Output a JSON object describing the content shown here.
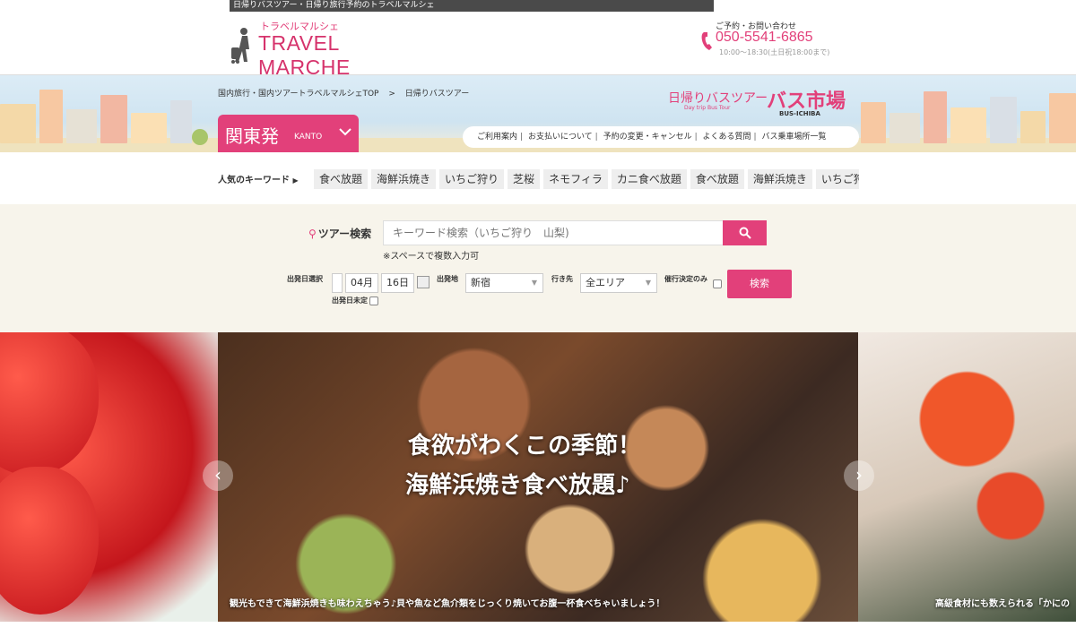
{
  "top_strip": {
    "text": "日帰りバスツアー・日帰り旅行予約のトラベルマルシェ"
  },
  "header": {
    "logo_ruby": "トラベルマルシェ",
    "logo_brand": "TRAVEL MARCHE",
    "contact_label": "ご予約・お問い合わせ",
    "contact_tel": "050-5541-6865",
    "contact_hours": "10:00〜18:30(土日祝18:00まで)"
  },
  "breadcrumb": [
    "国内旅行・国内ツアートラベルマルシェTOP",
    ">",
    "日帰りバスツアー"
  ],
  "region": {
    "label_jp": "関東発",
    "label_en": "KANTO"
  },
  "bus_market": {
    "daytrip_label": "日帰りバスツアー",
    "daytrip_sub": "Day trip Bus Tour",
    "busichiba_label": "バス市場",
    "busichiba_sub": "BUS-ICHIBA"
  },
  "subnav": [
    "ご利用案内",
    "お支払いについて",
    "予約の変更・キャンセル",
    "よくある質問",
    "バス乗車場所一覧"
  ],
  "keywords": {
    "label": "人気のキーワード",
    "tags": [
      "食べ放題",
      "海鮮浜焼き",
      "いちご狩り",
      "芝桜",
      "ネモフィラ",
      "カニ食べ放題",
      "食べ放題",
      "海鮮浜焼き",
      "いちご狩り"
    ]
  },
  "search": {
    "title": "ツアー検索",
    "placeholder": "キーワード検索（いちご狩り　山梨)",
    "note": "※スペースで複数入力可",
    "date_label": "出発日選択",
    "month": "04月",
    "day": "16日",
    "departure_label": "出発地",
    "departure_value": "新宿",
    "destination_label": "行き先",
    "destination_value": "全エリア",
    "guaranteed_label": "催行決定のみ",
    "undecided_label": "出発日未定",
    "submit_label": "検索"
  },
  "slider": {
    "catch_line1": "食欲がわくこの季節！",
    "catch_line2": "海鮮浜焼き食べ放題♪",
    "caption_main": "観光もできて海鮮浜焼きも味わえちゃう♪貝や魚など魚介類をじっくり焼いてお腹一杯食べちゃいましょう！",
    "caption_right": "高級食材にも数えられる「かにの",
    "prev_label": "‹",
    "next_label": "›"
  },
  "colors": {
    "accent": "#e2407a",
    "search_bg": "#f7f4eb"
  }
}
